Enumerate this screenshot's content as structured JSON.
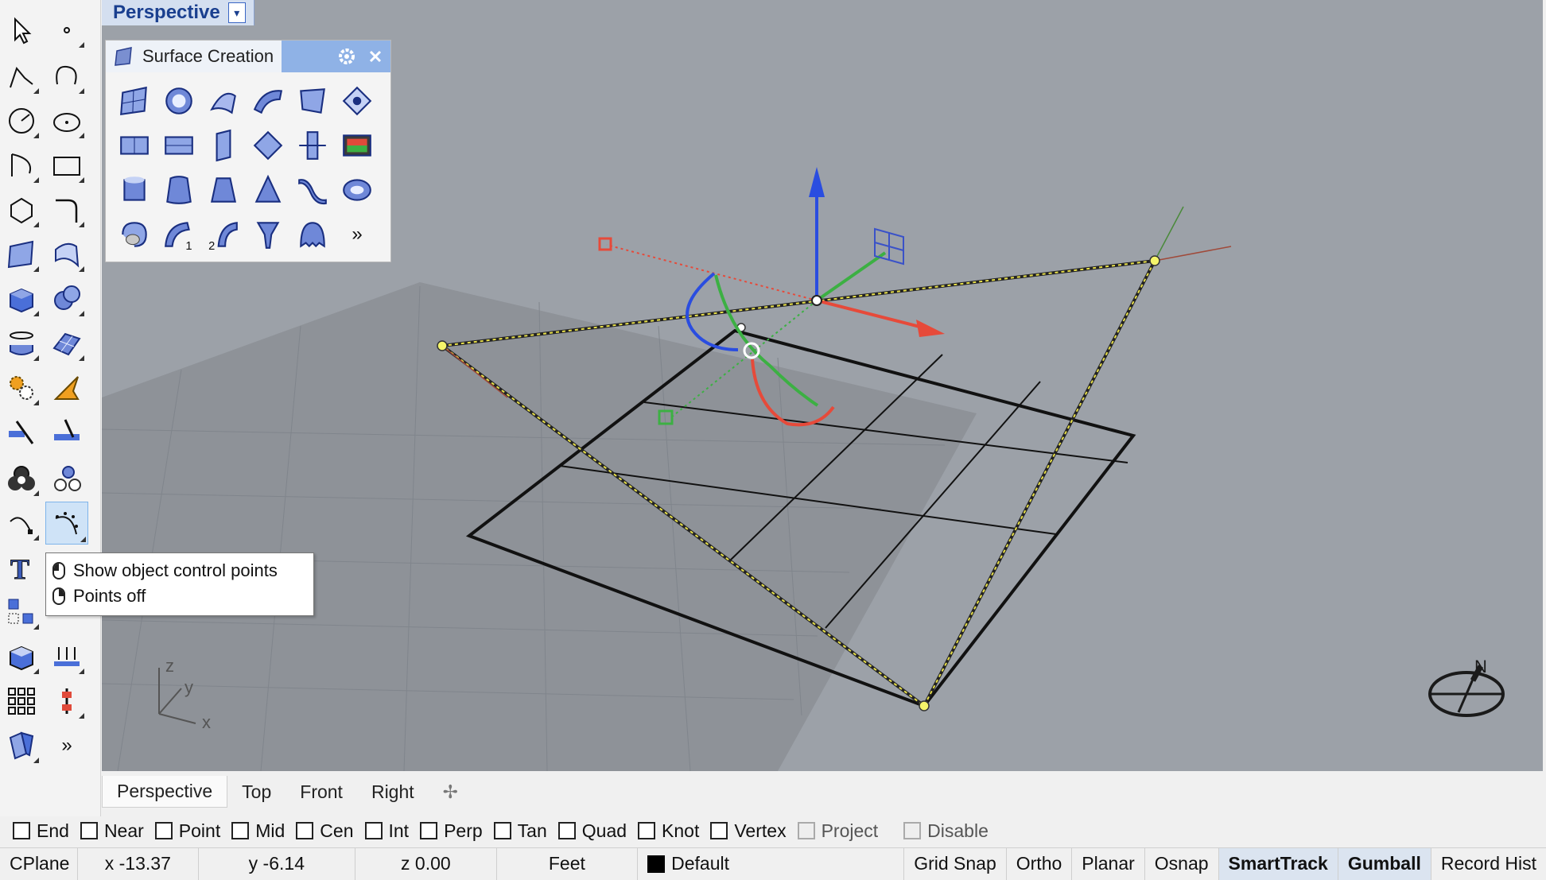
{
  "viewport": {
    "title": "Perspective",
    "dropdown_glyph": "▾"
  },
  "panel": {
    "title": "Surface Creation",
    "icon": "surface-panel-icon",
    "more_glyph": "»",
    "label_1": "1",
    "label_2": "2"
  },
  "tooltip": {
    "left_click": "Show object control points",
    "right_click": "Points off"
  },
  "toolbar": {
    "more_glyph": "»"
  },
  "tabs": [
    "Perspective",
    "Top",
    "Front",
    "Right"
  ],
  "tab_add_glyph": "✢",
  "osnaps": [
    {
      "label": "End",
      "checked": false
    },
    {
      "label": "Near",
      "checked": false
    },
    {
      "label": "Point",
      "checked": false
    },
    {
      "label": "Mid",
      "checked": false
    },
    {
      "label": "Cen",
      "checked": false
    },
    {
      "label": "Int",
      "checked": false
    },
    {
      "label": "Perp",
      "checked": false
    },
    {
      "label": "Tan",
      "checked": false
    },
    {
      "label": "Quad",
      "checked": false
    },
    {
      "label": "Knot",
      "checked": false
    },
    {
      "label": "Vertex",
      "checked": false
    },
    {
      "label": "Project",
      "checked": false,
      "disabled": true
    },
    {
      "label": "Disable",
      "checked": false,
      "disabled": true
    }
  ],
  "status": {
    "cplane": "CPlane",
    "x": "x -13.37",
    "y": "y -6.14",
    "z": "z 0.00",
    "units": "Feet",
    "layer": "Default",
    "grid_snap": "Grid Snap",
    "ortho": "Ortho",
    "planar": "Planar",
    "osnap": "Osnap",
    "smarttrack": "SmartTrack",
    "gumball": "Gumball",
    "record_history": "Record Hist"
  },
  "axis_labels": {
    "x": "x",
    "y": "y",
    "z": "z",
    "n": "N"
  },
  "colors": {
    "viewport_bg": "#9ca1a8",
    "accent": "#1a3f8f",
    "x_axis": "#e64a3a",
    "y_axis": "#3cb043",
    "z_axis": "#2a4de0"
  }
}
